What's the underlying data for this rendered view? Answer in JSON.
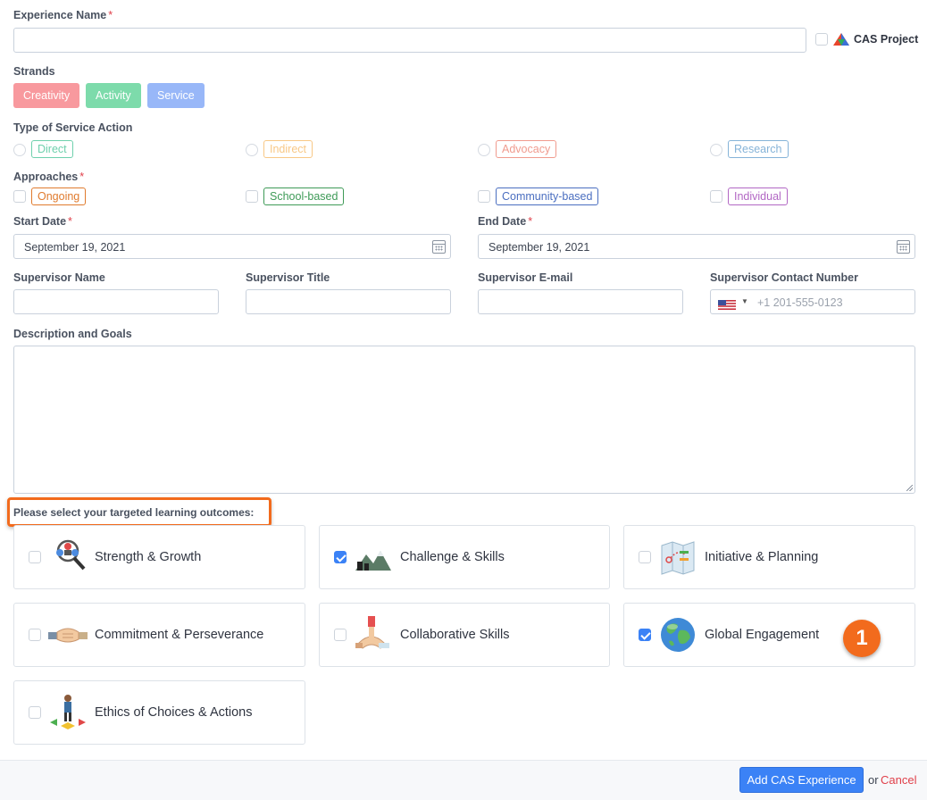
{
  "experience_name": {
    "label": "Experience Name",
    "required": "*",
    "value": ""
  },
  "cas_project": {
    "label": "CAS Project",
    "checked": false,
    "icon": "cas-logo-icon"
  },
  "strands": {
    "label": "Strands",
    "items": [
      {
        "label": "Creativity",
        "color": "#f8999e"
      },
      {
        "label": "Activity",
        "color": "#7ddbab"
      },
      {
        "label": "Service",
        "color": "#98b7f8"
      }
    ]
  },
  "service_action": {
    "label": "Type of Service Action",
    "options": [
      {
        "label": "Direct",
        "color": "#6fd0ad"
      },
      {
        "label": "Indirect",
        "color": "#f8c886"
      },
      {
        "label": "Advocacy",
        "color": "#f09b8e"
      },
      {
        "label": "Research",
        "color": "#85b3d8"
      }
    ]
  },
  "approaches": {
    "label": "Approaches",
    "required": "*",
    "options": [
      {
        "label": "Ongoing",
        "color": "#e07b2e"
      },
      {
        "label": "School-based",
        "color": "#3e9a57"
      },
      {
        "label": "Community-based",
        "color": "#4a6ec0"
      },
      {
        "label": "Individual",
        "color": "#b267c4"
      }
    ]
  },
  "start_date": {
    "label": "Start Date",
    "required": "*",
    "value": "September 19, 2021"
  },
  "end_date": {
    "label": "End Date",
    "required": "*",
    "value": "September 19, 2021"
  },
  "supervisor": {
    "name_label": "Supervisor Name",
    "title_label": "Supervisor Title",
    "email_label": "Supervisor E-mail",
    "phone_label": "Supervisor Contact Number",
    "phone_placeholder": "+1 201-555-0123",
    "phone_flag": "us-flag-icon"
  },
  "description": {
    "label": "Description and Goals",
    "value": ""
  },
  "outcomes": {
    "prompt": "Please select your targeted learning outcomes:",
    "highlight_color": "#f26b1d",
    "items": [
      {
        "label": "Strength & Growth",
        "checked": false,
        "icon": "strength-growth-icon"
      },
      {
        "label": "Challenge & Skills",
        "checked": true,
        "icon": "challenge-skills-icon"
      },
      {
        "label": "Initiative & Planning",
        "checked": false,
        "icon": "initiative-planning-icon"
      },
      {
        "label": "Commitment & Perseverance",
        "checked": false,
        "icon": "commitment-perseverance-icon"
      },
      {
        "label": "Collaborative Skills",
        "checked": false,
        "icon": "collaborative-skills-icon"
      },
      {
        "label": "Global Engagement",
        "checked": true,
        "icon": "global-engagement-icon"
      },
      {
        "label": "Ethics of Choices & Actions",
        "checked": false,
        "icon": "ethics-choices-icon"
      }
    ]
  },
  "callout": {
    "number": "1",
    "color": "#f26b1d"
  },
  "footer": {
    "submit_label": "Add CAS Experience",
    "or_text": "or",
    "cancel_label": "Cancel",
    "cancel_color": "#e0404a"
  }
}
